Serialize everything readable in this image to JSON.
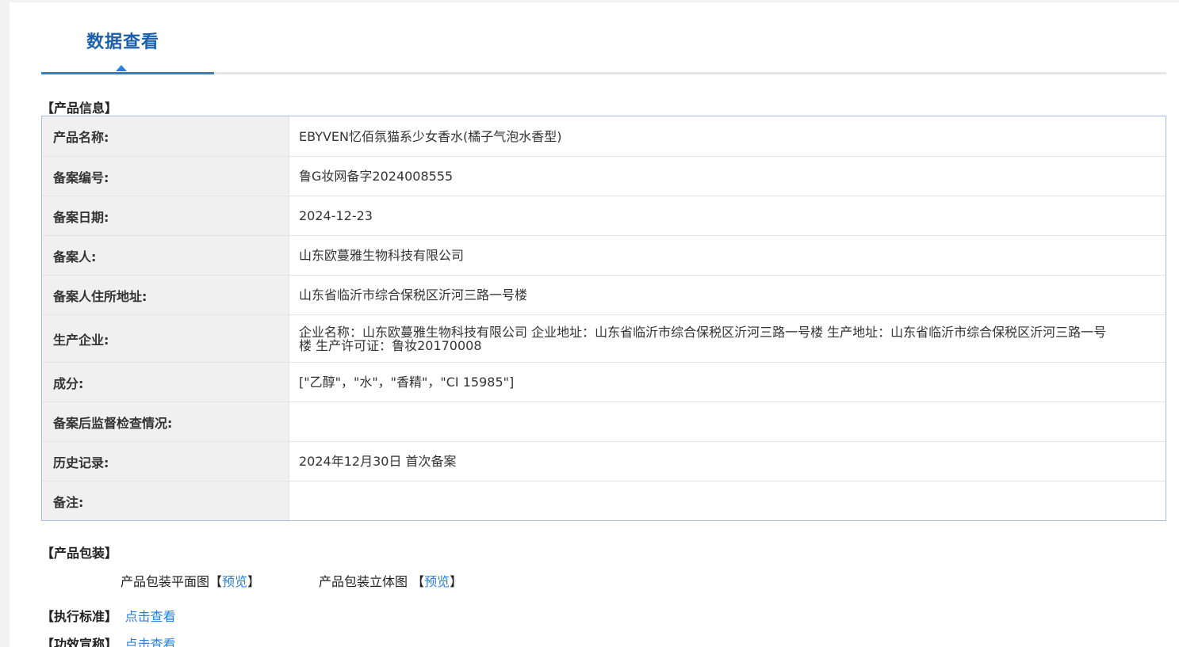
{
  "tab": {
    "label": "数据查看"
  },
  "sections": {
    "product_info": "【产品信息】",
    "packaging": "【产品包装】",
    "standard": "【执行标准】",
    "efficacy": "【功效宣称】"
  },
  "product_rows": [
    {
      "label": "产品名称:",
      "value": "EBYVEN忆佰氛猫系少女香水(橘子气泡水香型)"
    },
    {
      "label": "备案编号:",
      "value": "鲁G妆网备字2024008555"
    },
    {
      "label": "备案日期:",
      "value": "2024-12-23"
    },
    {
      "label": "备案人:",
      "value": "山东欧蔓雅生物科技有限公司"
    },
    {
      "label": "备案人住所地址:",
      "value": "山东省临沂市综合保税区沂河三路一号楼"
    },
    {
      "label": "生产企业:",
      "value": "企业名称：山东欧蔓雅生物科技有限公司 企业地址：山东省临沂市综合保税区沂河三路一号楼 生产地址：山东省临沂市综合保税区沂河三路一号楼 生产许可证：鲁妆20170008"
    },
    {
      "label": "成分:",
      "value": "[\"乙醇\"，\"水\"，\"香精\"，\"CI 15985\"]"
    },
    {
      "label": "备案后监督检查情况:",
      "value": ""
    },
    {
      "label": "历史记录:",
      "value": "2024年12月30日 首次备案"
    },
    {
      "label": "备注:",
      "value": ""
    }
  ],
  "packaging": {
    "flat_label": "产品包装平面图",
    "flat_open": "【",
    "flat_link": "预览",
    "flat_close": "】",
    "solid_label": "产品包装立体图 ",
    "solid_open": "【",
    "solid_link": "预览",
    "solid_close": "】"
  },
  "standard_link": "点击查看",
  "efficacy_link": "点击查看",
  "colors": {
    "accent": "#2a83d1",
    "tab_text": "#1a5fa8",
    "link": "#2a7fd4",
    "table_border": "#a8bfdc",
    "label_bg": "#f0f0f0"
  }
}
